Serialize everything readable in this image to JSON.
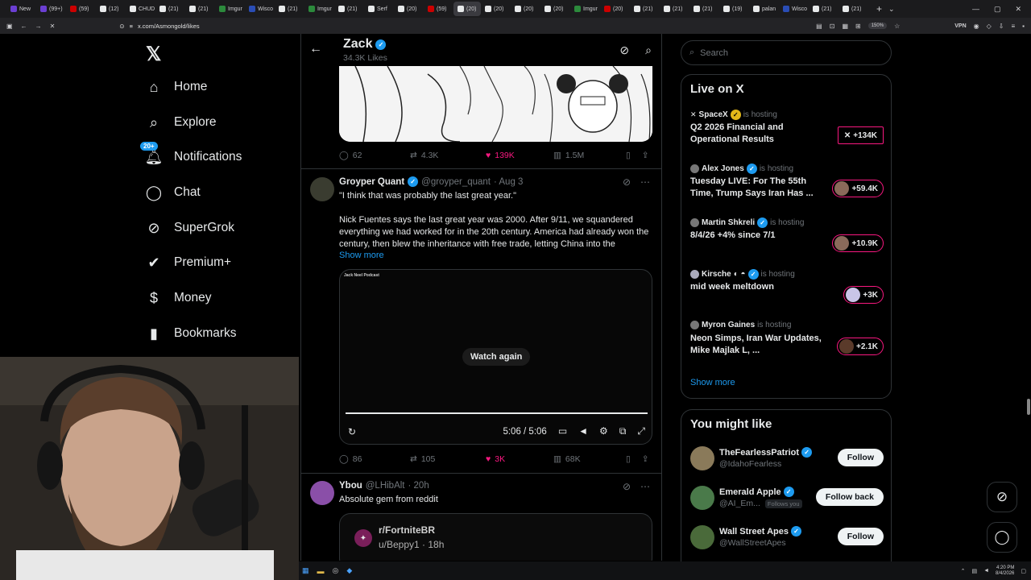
{
  "browser": {
    "tabs": [
      {
        "label": "New",
        "color": "#6b3fd3"
      },
      {
        "label": "(99+)",
        "color": "#6b3fd3"
      },
      {
        "label": "(59)",
        "color": "#c00"
      },
      {
        "label": "(12)",
        "color": "#e7e9ea"
      },
      {
        "label": "CHUD",
        "color": "#e7e9ea"
      },
      {
        "label": "(21)",
        "color": "#e7e9ea"
      },
      {
        "label": "(21)",
        "color": "#e7e9ea"
      },
      {
        "label": "Imgur",
        "color": "#2c8a3c"
      },
      {
        "label": "Wisco",
        "color": "#2a4db5"
      },
      {
        "label": "(21)",
        "color": "#e7e9ea"
      },
      {
        "label": "Imgur",
        "color": "#2c8a3c"
      },
      {
        "label": "(21)",
        "color": "#e7e9ea"
      },
      {
        "label": "Serf",
        "color": "#e7e9ea"
      },
      {
        "label": "(20)",
        "color": "#e7e9ea"
      },
      {
        "label": "(59)",
        "color": "#c00"
      },
      {
        "label": "(20)",
        "color": "#e7e9ea"
      },
      {
        "label": "(20)",
        "color": "#e7e9ea"
      },
      {
        "label": "(20)",
        "color": "#e7e9ea"
      },
      {
        "label": "(20)",
        "color": "#e7e9ea"
      },
      {
        "label": "Imgur",
        "color": "#2c8a3c"
      },
      {
        "label": "(20)",
        "color": "#c00"
      },
      {
        "label": "(21)",
        "color": "#e7e9ea"
      },
      {
        "label": "(21)",
        "color": "#e7e9ea"
      },
      {
        "label": "(21)",
        "color": "#e7e9ea"
      },
      {
        "label": "(19)",
        "color": "#e7e9ea"
      },
      {
        "label": "palan",
        "color": "#e7e9ea"
      },
      {
        "label": "Wisco",
        "color": "#2a4db5"
      },
      {
        "label": "(21)",
        "color": "#e7e9ea"
      },
      {
        "label": "(21)",
        "color": "#e7e9ea"
      }
    ],
    "active_tab_index": 15,
    "url": "x.com/Asmongold/likes",
    "zoom": "150%",
    "vpn": "VPN"
  },
  "nav": {
    "logo": "𝕏",
    "items": [
      {
        "label": "Home",
        "icon": "⌂"
      },
      {
        "label": "Explore",
        "icon": "⌕"
      },
      {
        "label": "Notifications",
        "icon": "🔔︎",
        "badge": "20+"
      },
      {
        "label": "Chat",
        "icon": "◯"
      },
      {
        "label": "SuperGrok",
        "icon": "⊘"
      },
      {
        "label": "Premium+",
        "icon": "✔"
      },
      {
        "label": "Money",
        "icon": "$"
      },
      {
        "label": "Bookmarks",
        "icon": "▮"
      }
    ]
  },
  "header": {
    "name": "Zack",
    "subtitle": "34.3K Likes"
  },
  "tweets": [
    {
      "stats": {
        "replies": "62",
        "retweets": "4.3K",
        "likes": "139K",
        "views": "1.5M"
      }
    },
    {
      "name": "Groyper Quant",
      "handle": "@groyper_quant",
      "time": "· Aug 3",
      "quote": "\"I think that was probably the last great year.\"",
      "body": "Nick Fuentes says the last great year was 2000. After 9/11, we squandered everything we had worked for in the 20th century. America had already won the century, then blew the inheritance with free trade, letting China into the",
      "show_more": "Show more",
      "video": {
        "label": "Jack Neel Podcast",
        "watch_again": "Watch again",
        "time": "5:06 / 5:06",
        "progress": 1.0
      },
      "stats": {
        "replies": "86",
        "retweets": "105",
        "likes": "3K",
        "views": "68K"
      }
    },
    {
      "name": "Ybou",
      "handle": "@LHibAlt",
      "time": "· 20h",
      "body": "Absolute gem from reddit",
      "reddit": {
        "sub": "r/FortniteBR",
        "user": "u/Beppy1 · 18h"
      }
    }
  ],
  "search": {
    "placeholder": "Search"
  },
  "live": {
    "title": "Live on X",
    "items": [
      {
        "host": "SpaceX",
        "is": "is hosting",
        "title": "Q2 2026 Financial and Operational Results",
        "count": "+134K",
        "verified": "gold"
      },
      {
        "host": "Alex Jones",
        "is": "is hosting",
        "title": "Tuesday LIVE: For The 55th Time, Trump Says Iran Has ...",
        "count": "+59.4K",
        "verified": "blue"
      },
      {
        "host": "Martin Shkreli",
        "is": "is hosting",
        "title": "8/4/26 +4% since 7/1",
        "count": "+10.9K",
        "verified": "blue"
      },
      {
        "host": "Kirsche",
        "is": "is hosting",
        "title": "mid week meltdown",
        "count": "+3K",
        "verified": "blue"
      },
      {
        "host": "Myron Gaines",
        "is": "is hosting",
        "title": "Neon Simps, Iran War Updates, Mike Majlak L, ...",
        "count": "+2.1K",
        "verified": "none"
      }
    ],
    "show_more": "Show more"
  },
  "suggest": {
    "title": "You might like",
    "items": [
      {
        "name": "TheFearlessPatriot",
        "handle": "@IdahoFearless",
        "button": "Follow",
        "follows_you": ""
      },
      {
        "name": "Emerald Apple",
        "handle": "@AI_Em...",
        "button": "Follow back",
        "follows_you": "Follows you"
      },
      {
        "name": "Wall Street Apes",
        "handle": "@WallStreetApes",
        "button": "Follow",
        "follows_you": ""
      }
    ]
  },
  "taskbar": {
    "time": "4:20 PM",
    "date": "8/4/2026"
  },
  "colors": {
    "accent": "#1d9bf0",
    "like": "#f91880",
    "border": "#2f3336",
    "muted": "#71767b"
  }
}
